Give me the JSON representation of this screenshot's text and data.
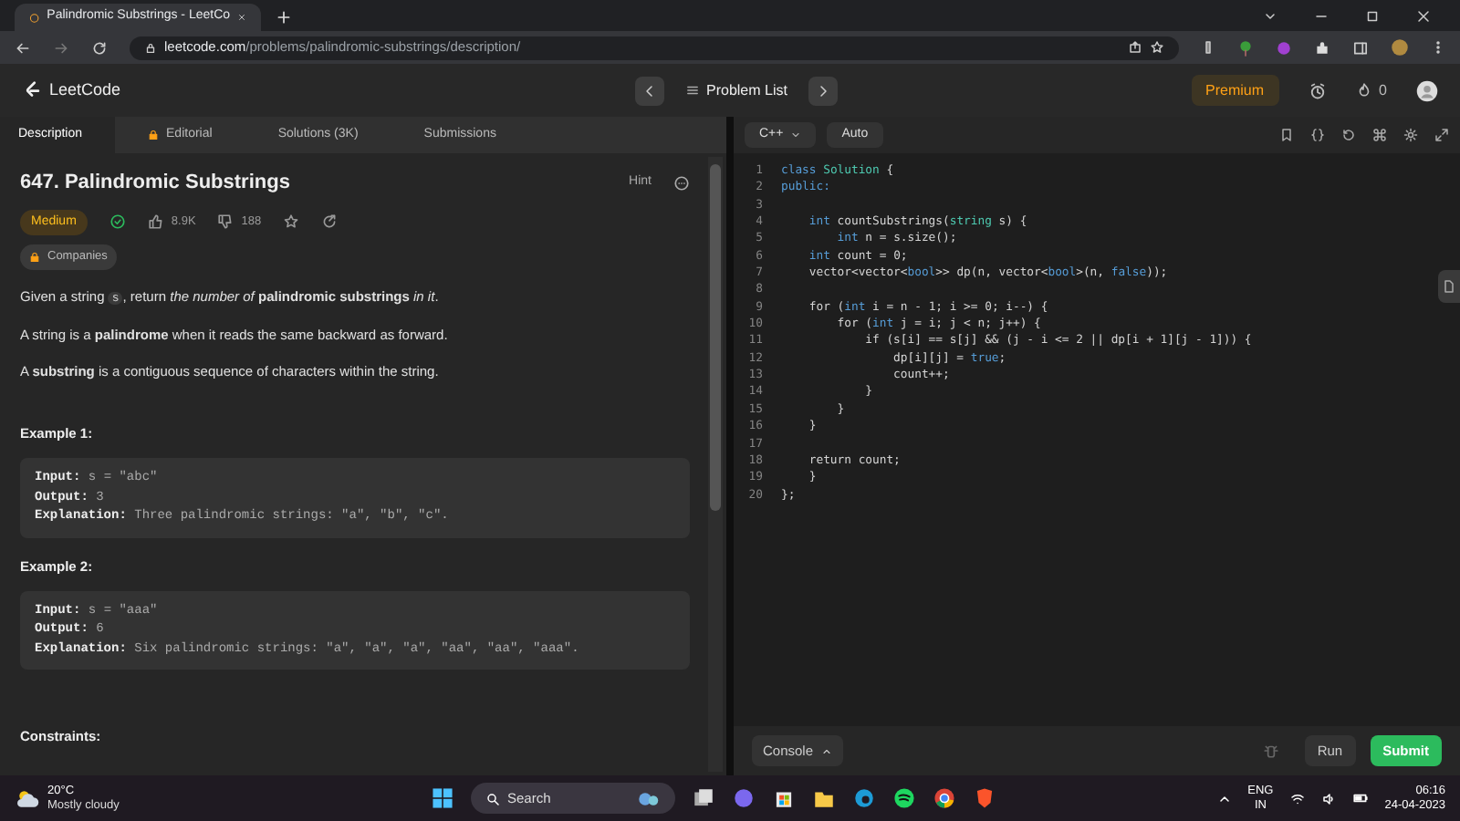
{
  "browser": {
    "tabs": [
      {
        "title": "Palindromic Substrings - LeetCo",
        "selected": true
      }
    ],
    "url_host": "leetcode.com",
    "url_path": "/problems/palindromic-substrings/description/"
  },
  "header": {
    "logo": "LeetCode",
    "problem_list": "Problem List",
    "premium": "Premium",
    "streak": "0"
  },
  "left_tabs": [
    {
      "label": "Description",
      "selected": true,
      "locked": false
    },
    {
      "label": "Editorial",
      "selected": false,
      "locked": true
    },
    {
      "label": "Solutions (3K)",
      "selected": false,
      "locked": false
    },
    {
      "label": "Submissions",
      "selected": false,
      "locked": false
    }
  ],
  "problem": {
    "title": "647. Palindromic Substrings",
    "hint": "Hint",
    "difficulty": "Medium",
    "solved": true,
    "likes": "8.9K",
    "dislikes": "188",
    "companies": "Companies",
    "paragraphs": [
      [
        {
          "kind": "text",
          "text": "Given a string "
        },
        {
          "kind": "code",
          "text": "s"
        },
        {
          "kind": "text",
          "text": ", return *the number of* **palindromic substrings** *in it*."
        }
      ],
      [
        {
          "kind": "text",
          "text": "A string is a **palindrome** when it reads the same backward as forward."
        }
      ],
      [
        {
          "kind": "text",
          "text": "A **substring** is a contiguous sequence of characters within the string."
        }
      ]
    ],
    "examples": [
      {
        "title": "Example 1:",
        "lines": [
          {
            "label": "Input:",
            "value": "s = \"abc\""
          },
          {
            "label": "Output:",
            "value": "3"
          },
          {
            "label": "Explanation:",
            "value": "Three palindromic strings: \"a\", \"b\", \"c\"."
          }
        ]
      },
      {
        "title": "Example 2:",
        "lines": [
          {
            "label": "Input:",
            "value": "s = \"aaa\""
          },
          {
            "label": "Output:",
            "value": "6"
          },
          {
            "label": "Explanation:",
            "value": "Six palindromic strings: \"a\", \"a\", \"a\", \"aa\", \"aa\", \"aaa\"."
          }
        ]
      }
    ],
    "constraints": "Constraints:"
  },
  "editor": {
    "language": "C++",
    "mode": "Auto",
    "lines": [
      {
        "number": "1",
        "tokens": [
          {
            "kind": "kw",
            "text": "class"
          },
          {
            "kind": "type",
            "text": " Solution"
          },
          {
            "kind": "plain",
            "text": " {"
          }
        ]
      },
      {
        "number": "2",
        "tokens": [
          {
            "kind": "kw",
            "text": "public:"
          }
        ]
      },
      {
        "number": "3"
      },
      {
        "number": "4",
        "tokens": [
          {
            "kind": "kw",
            "text": "    int"
          },
          {
            "kind": "plain",
            "text": " countSubstrings("
          },
          {
            "kind": "type",
            "text": "string"
          },
          {
            "kind": "plain",
            "text": " s) {"
          }
        ]
      },
      {
        "number": "5",
        "tokens": [
          {
            "kind": "kw",
            "text": "        int"
          },
          {
            "kind": "plain",
            "text": " n = s.size();"
          }
        ]
      },
      {
        "number": "6",
        "tokens": [
          {
            "kind": "kw",
            "text": "    int"
          },
          {
            "kind": "plain",
            "text": " count = 0;"
          }
        ]
      },
      {
        "number": "7",
        "tokens": [
          {
            "kind": "plain",
            "text": "    vector<vector<"
          },
          {
            "kind": "kw",
            "text": "bool"
          },
          {
            "kind": "plain",
            "text": ">> dp(n, vector<"
          },
          {
            "kind": "kw",
            "text": "bool"
          },
          {
            "kind": "plain",
            "text": ">(n, "
          },
          {
            "kind": "kw",
            "text": "false"
          },
          {
            "kind": "plain",
            "text": "));"
          }
        ]
      },
      {
        "number": "8"
      },
      {
        "number": "9",
        "tokens": [
          {
            "kind": "plain",
            "text": "    for ("
          },
          {
            "kind": "kw",
            "text": "int"
          },
          {
            "kind": "plain",
            "text": " i = n - 1; i >= 0; i--) {"
          }
        ]
      },
      {
        "number": "10",
        "tokens": [
          {
            "kind": "plain",
            "text": "        for ("
          },
          {
            "kind": "kw",
            "text": "int"
          },
          {
            "kind": "plain",
            "text": " j = i; j < n; j++) {"
          }
        ]
      },
      {
        "number": "11",
        "tokens": [
          {
            "kind": "plain",
            "text": "            if (s[i] == s[j] && (j - i <= 2 || dp[i + 1][j - 1])) {"
          }
        ]
      },
      {
        "number": "12",
        "tokens": [
          {
            "kind": "plain",
            "text": "                dp[i][j] = "
          },
          {
            "kind": "kw",
            "text": "true"
          },
          {
            "kind": "plain",
            "text": ";"
          }
        ]
      },
      {
        "number": "13",
        "tokens": [
          {
            "kind": "plain",
            "text": "                count++;"
          }
        ]
      },
      {
        "number": "14",
        "tokens": [
          {
            "kind": "plain",
            "text": "            }"
          }
        ]
      },
      {
        "number": "15",
        "tokens": [
          {
            "kind": "plain",
            "text": "        }"
          }
        ]
      },
      {
        "number": "16",
        "tokens": [
          {
            "kind": "plain",
            "text": "    }"
          }
        ]
      },
      {
        "number": "17"
      },
      {
        "number": "18",
        "tokens": [
          {
            "kind": "plain",
            "text": "    return count;"
          }
        ]
      },
      {
        "number": "19",
        "tokens": [
          {
            "kind": "plain",
            "text": "    }"
          }
        ]
      },
      {
        "number": "20",
        "tokens": [
          {
            "kind": "plain",
            "text": "};"
          }
        ]
      }
    ],
    "console": "Console",
    "run": "Run",
    "submit": "Submit"
  },
  "taskbar": {
    "temperature": "20°C",
    "weather": "Mostly cloudy",
    "search": "Search",
    "language": "ENG",
    "region": "IN",
    "time": "06:16",
    "date": "24-04-2023"
  }
}
